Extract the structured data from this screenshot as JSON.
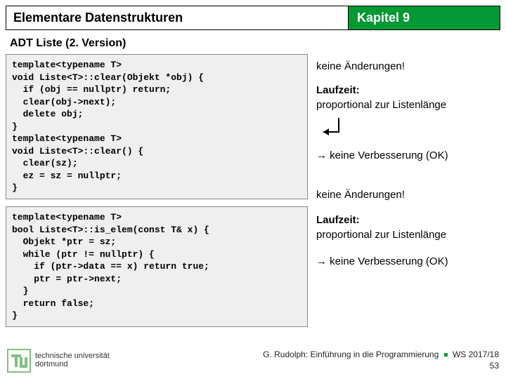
{
  "header": {
    "left": "Elementare Datenstrukturen",
    "right": "Kapitel 9"
  },
  "subtitle": "ADT Liste (2. Version)",
  "code1": "template<typename T>\nvoid Liste<T>::clear(Objekt *obj) {\n  if (obj == nullptr) return;\n  clear(obj->next);\n  delete obj;\n}\ntemplate<typename T>\nvoid Liste<T>::clear() {\n  clear(sz);\n  ez = sz = nullptr;\n}",
  "code2": "template<typename T>\nbool Liste<T>::is_elem(const T& x) {\n  Objekt *ptr = sz;\n  while (ptr != nullptr) {\n    if (ptr->data == x) return true;\n    ptr = ptr->next;\n  }\n  return false;\n}",
  "ann1": {
    "nochange": "keine Änderungen!",
    "runtime_label": "Laufzeit:",
    "runtime_text": "proportional zur Listenlänge",
    "conclusion": "→ keine Verbesserung (OK)"
  },
  "ann2": {
    "nochange": "keine Änderungen!",
    "runtime_label": "Laufzeit:",
    "runtime_text": "proportional zur Listenlänge",
    "conclusion": "→ keine Verbesserung (OK)"
  },
  "footer": {
    "uni1": "technische universität",
    "uni2": "dortmund",
    "credit": "G. Rudolph: Einführung in die Programmierung",
    "term": "WS 2017/18",
    "page": "53"
  },
  "colors": {
    "accent": "#009933"
  }
}
